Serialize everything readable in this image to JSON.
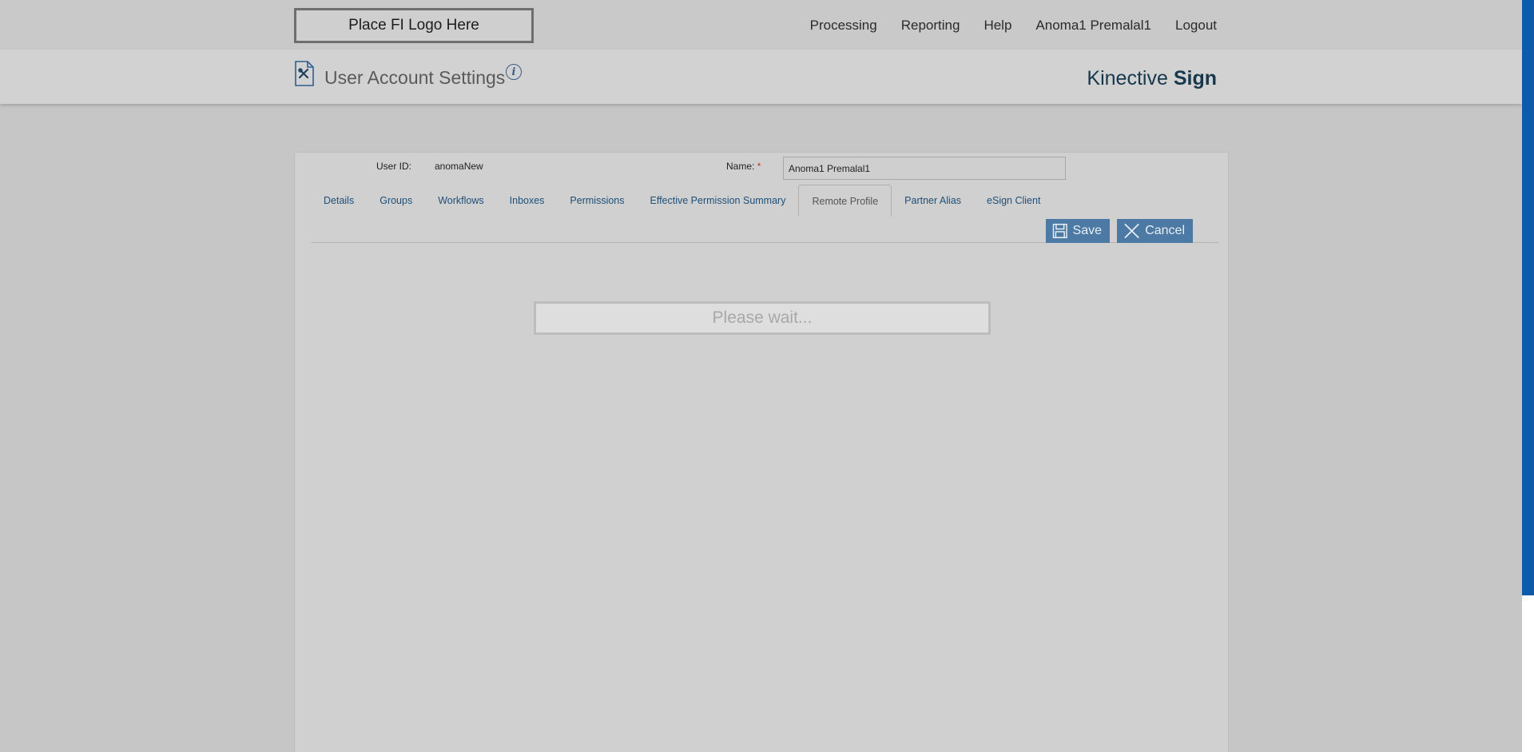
{
  "header": {
    "logo_text": "Place FI Logo Here",
    "nav": [
      "Processing",
      "Reporting",
      "Help",
      "Anoma1 Premalal1",
      "Logout"
    ]
  },
  "subheader": {
    "title": "User Account Settings",
    "info_icon": "i",
    "brand_light": "Kinective",
    "brand_bold": "Sign"
  },
  "form": {
    "user_id_label": "User ID:",
    "user_id_value": "anomaNew",
    "name_label": "Name:",
    "required_mark": "*",
    "name_value": "Anoma1 Premalal1"
  },
  "tabs": [
    {
      "label": "Details"
    },
    {
      "label": "Groups"
    },
    {
      "label": "Workflows"
    },
    {
      "label": "Inboxes"
    },
    {
      "label": "Permissions"
    },
    {
      "label": "Effective Permission Summary"
    },
    {
      "label": "Remote Profile",
      "active": true
    },
    {
      "label": "Partner Alias"
    },
    {
      "label": "eSign Client"
    }
  ],
  "actions": {
    "save_label": "Save",
    "cancel_label": "Cancel"
  },
  "status": {
    "wait_text": "Please wait..."
  },
  "colors": {
    "button_bg": "#4d7aa4",
    "link": "#1e4f78",
    "scrollbar": "#0d5aa8"
  }
}
